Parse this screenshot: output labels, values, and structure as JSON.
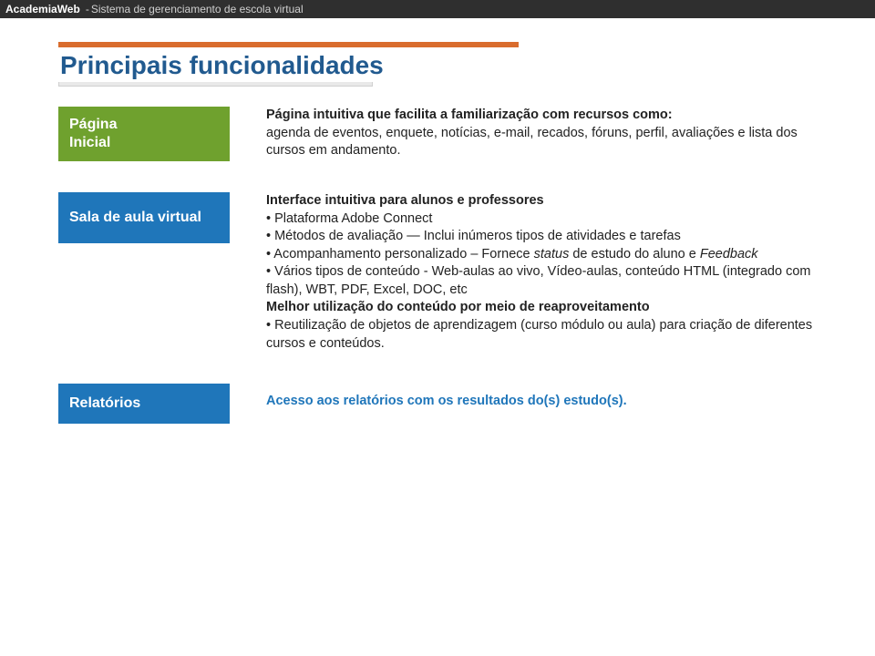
{
  "topbar": {
    "brand": "AcademiaWeb",
    "subtitle": "Sistema de gerenciamento de escola virtual"
  },
  "title": "Principais funcionalidades",
  "rows": {
    "pagina_inicial": {
      "label_l1": "Página",
      "label_l2": "Inicial",
      "lead": "Página intuitiva que facilita a familiarização com recursos como:",
      "body": "agenda de eventos, enquete, notícias, e-mail, recados, fóruns, perfil, avaliações e lista dos cursos em andamento."
    },
    "sala": {
      "label": "Sala de aula virtual",
      "lead": "Interface intuitiva para alunos e professores",
      "b1": "• Plataforma Adobe Connect",
      "b2": "• Métodos de avaliação  — Inclui inúmeros tipos de atividades e tarefas",
      "b3a": "• Acompanhamento personalizado – Fornece ",
      "b3_em": "status",
      "b3b": " de estudo do aluno e ",
      "b3_em2": "Feedback",
      "b4": "• Vários tipos de conteúdo  - Web-aulas ao vivo, Vídeo-aulas, conteúdo HTML (integrado com flash), WBT, PDF, Excel, DOC, etc",
      "sub_lead": "Melhor utilização do conteúdo por meio de reaproveitamento",
      "b5": "• Reutilização de objetos de aprendizagem (curso módulo ou aula) para criação de diferentes cursos e conteúdos."
    },
    "relatorios": {
      "label": "Relatórios",
      "text": "Acesso aos relatórios com os resultados do(s) estudo(s)."
    }
  }
}
